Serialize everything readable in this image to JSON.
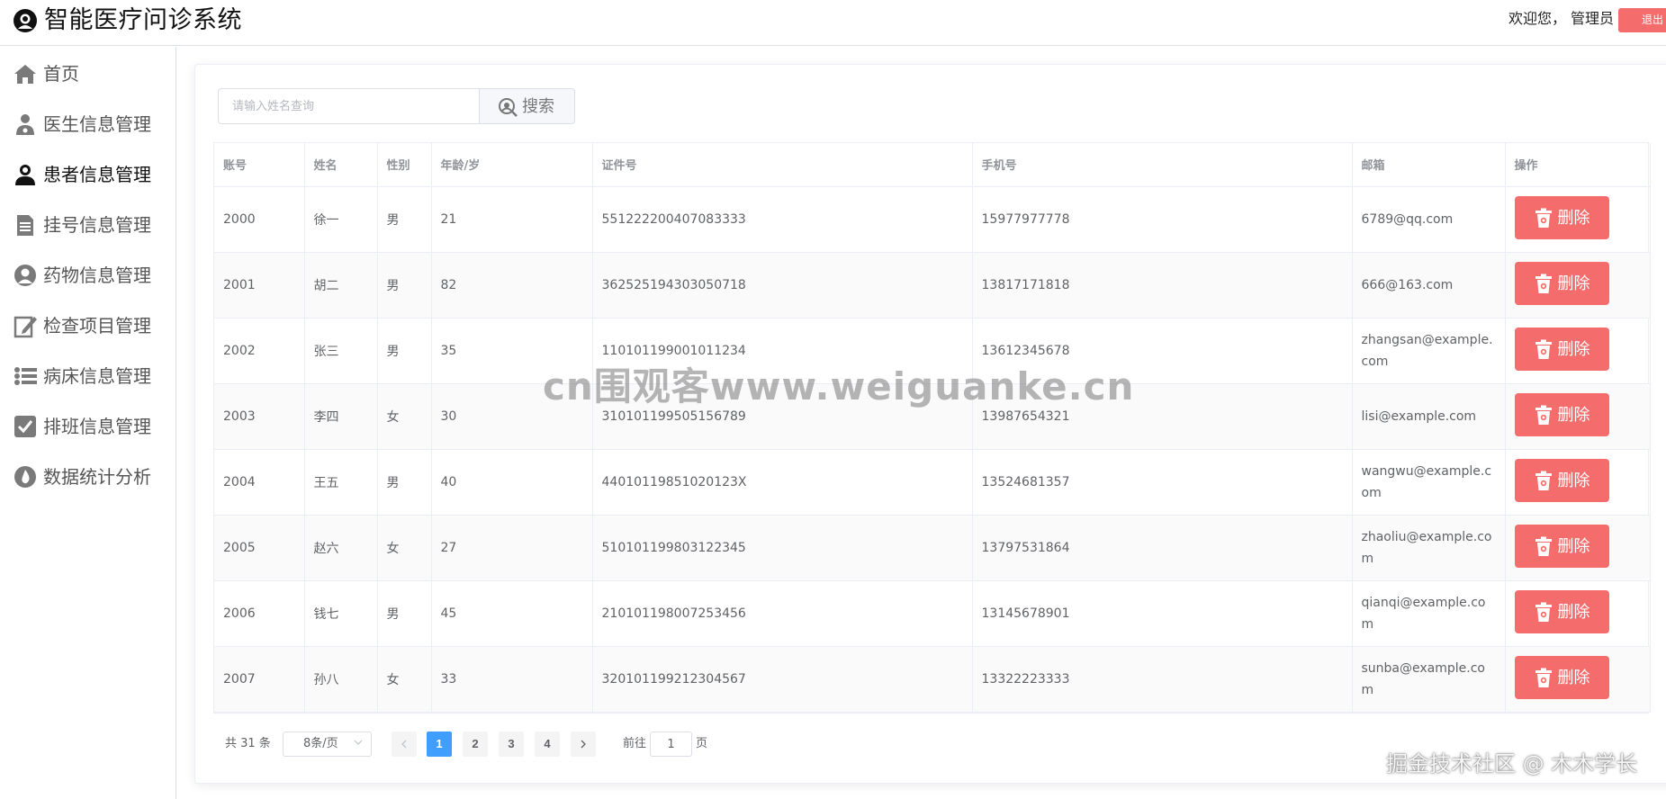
{
  "header": {
    "title": "智能医疗问诊系统",
    "welcome": "欢迎您，",
    "user": "管理员",
    "logout_label": "退出",
    "logo_icon": "user-circle-icon"
  },
  "sidebar": {
    "items": [
      {
        "label": "首页",
        "icon": "home-icon"
      },
      {
        "label": "医生信息管理",
        "icon": "doctor-icon"
      },
      {
        "label": "患者信息管理",
        "icon": "patient-icon",
        "active": true
      },
      {
        "label": "挂号信息管理",
        "icon": "document-icon"
      },
      {
        "label": "药物信息管理",
        "icon": "pill-icon"
      },
      {
        "label": "检查项目管理",
        "icon": "edit-icon"
      },
      {
        "label": "病床信息管理",
        "icon": "list-icon"
      },
      {
        "label": "排班信息管理",
        "icon": "checkbox-icon"
      },
      {
        "label": "数据统计分析",
        "icon": "drop-icon"
      }
    ]
  },
  "search": {
    "placeholder": "请输入姓名查询",
    "button_label": "搜索"
  },
  "table": {
    "columns": [
      "账号",
      "姓名",
      "性别",
      "年龄/岁",
      "证件号",
      "手机号",
      "邮箱",
      "操作"
    ],
    "delete_label": "删除",
    "rows": [
      {
        "account": "2000",
        "name": "徐一",
        "gender": "男",
        "age": "21",
        "id_no": "551222200407083333",
        "phone": "15977977778",
        "email": "6789@qq.com"
      },
      {
        "account": "2001",
        "name": "胡二",
        "gender": "男",
        "age": "82",
        "id_no": "362525194303050718",
        "phone": "13817171818",
        "email": "666@163.com"
      },
      {
        "account": "2002",
        "name": "张三",
        "gender": "男",
        "age": "35",
        "id_no": "110101199001011234",
        "phone": "13612345678",
        "email": "zhangsan@example.com"
      },
      {
        "account": "2003",
        "name": "李四",
        "gender": "女",
        "age": "30",
        "id_no": "310101199505156789",
        "phone": "13987654321",
        "email": "lisi@example.com"
      },
      {
        "account": "2004",
        "name": "王五",
        "gender": "男",
        "age": "40",
        "id_no": "44010119851020123X",
        "phone": "13524681357",
        "email": "wangwu@example.com"
      },
      {
        "account": "2005",
        "name": "赵六",
        "gender": "女",
        "age": "27",
        "id_no": "510101199803122345",
        "phone": "13797531864",
        "email": "zhaoliu@example.com"
      },
      {
        "account": "2006",
        "name": "钱七",
        "gender": "男",
        "age": "45",
        "id_no": "210101198007253456",
        "phone": "13145678901",
        "email": "qianqi@example.com"
      },
      {
        "account": "2007",
        "name": "孙八",
        "gender": "女",
        "age": "33",
        "id_no": "320101199212304567",
        "phone": "13322223333",
        "email": "sunba@example.com"
      }
    ]
  },
  "pagination": {
    "total": "共 31 条",
    "page_size": "8条/页",
    "pages": [
      "1",
      "2",
      "3",
      "4"
    ],
    "current": "1",
    "goto_prefix": "前往",
    "goto_value": "1",
    "goto_suffix": "页"
  },
  "watermarks": {
    "center": "cn围观客www.weiguanke.cn",
    "corner": "掘金技术社区 @ 木木学长"
  },
  "colors": {
    "danger": "#f56c6c",
    "primary": "#409eff",
    "border": "#ebeef5"
  }
}
